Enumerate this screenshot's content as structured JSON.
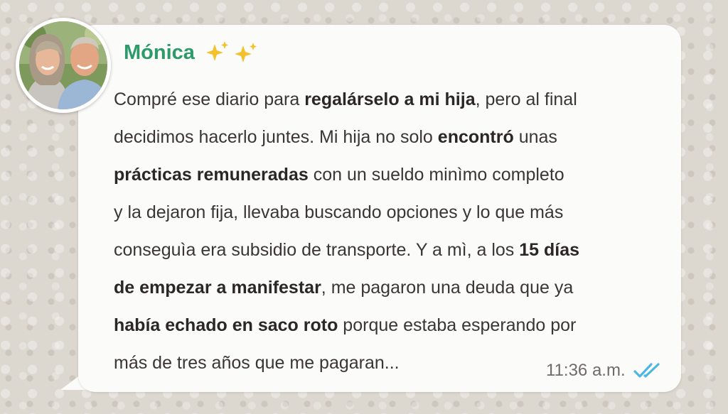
{
  "contact": {
    "name": "Mónica",
    "avatar_icon": "couple-photo-avatar",
    "emoji_icon": "sparkles-icon"
  },
  "message": {
    "lines": [
      [
        {
          "t": "Compré ese diario para ",
          "b": false
        },
        {
          "t": "regalárselo a mi hija",
          "b": true
        },
        {
          "t": ", pero al final",
          "b": false
        }
      ],
      [
        {
          "t": "decidimos hacerlo juntes. Mi hija no solo ",
          "b": false
        },
        {
          "t": "encontró",
          "b": true
        },
        {
          "t": " unas",
          "b": false
        }
      ],
      [
        {
          "t": "prácticas remuneradas",
          "b": true
        },
        {
          "t": " con un sueldo minìmo completo",
          "b": false
        }
      ],
      [
        {
          "t": "y la dejaron fija, llevaba buscando opciones y lo que más",
          "b": false
        }
      ],
      [
        {
          "t": "conseguìa era subsidio de transporte. Y a mì, a los ",
          "b": false
        },
        {
          "t": "15 días",
          "b": true
        }
      ],
      [
        {
          "t": "de empezar a manifestar",
          "b": true
        },
        {
          "t": ", me pagaron una deuda que ya",
          "b": false
        }
      ],
      [
        {
          "t": "había echado en saco roto",
          "b": true
        },
        {
          "t": " porque estaba esperando por",
          "b": false
        }
      ],
      [
        {
          "t": "más de tres años que me pagaran...",
          "b": false
        }
      ]
    ],
    "time": "11:36 a.m.",
    "status_icon": "double-check-read-icon"
  },
  "colors": {
    "name_green": "#2d9a6a",
    "sparkle_gold": "#f2c12e",
    "read_check_blue": "#4fb6e3",
    "bubble_bg": "#fbfbf9",
    "wallpaper": "#dcd7cf"
  }
}
